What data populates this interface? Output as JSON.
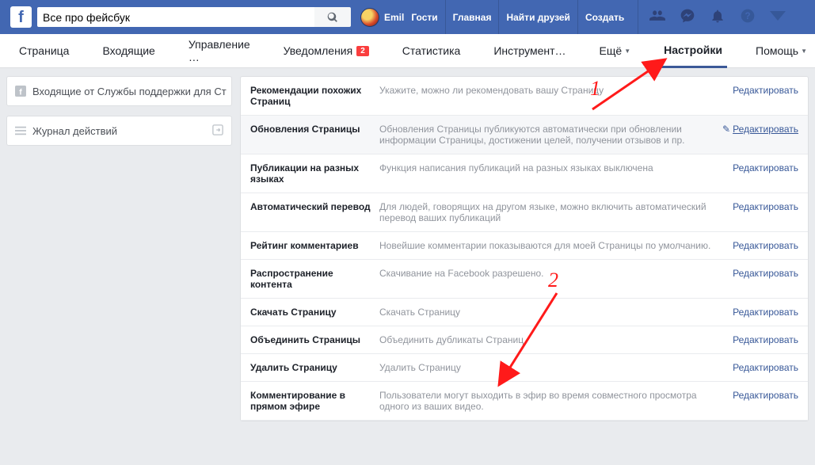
{
  "header": {
    "search_value": "Все про фейсбук",
    "user_name": "Emil",
    "nav": {
      "guests": "Гости",
      "home": "Главная",
      "find_friends": "Найти друзей",
      "create": "Создать"
    }
  },
  "tabs": {
    "page": "Страница",
    "inbox": "Входящие",
    "manage": "Управление …",
    "notifications": "Уведомления",
    "notifications_badge": "2",
    "insights": "Статистика",
    "tools": "Инструмент…",
    "more": "Ещё",
    "settings": "Настройки",
    "help": "Помощь"
  },
  "sidebar": {
    "support_inbox": "Входящие от Службы поддержки для Ст",
    "activity_log": "Журнал действий"
  },
  "rows": [
    {
      "label": "Рекомендации похожих Страниц",
      "desc": "Укажите, можно ли рекомендовать вашу Страницу",
      "highlight": false,
      "has_pencil": false,
      "underline": false
    },
    {
      "label": "Обновления Страницы",
      "desc": "Обновления Страницы публикуются автоматически при обновлении информации Страницы, достижении целей, получении отзывов и пр.",
      "highlight": true,
      "has_pencil": true,
      "underline": true
    },
    {
      "label": "Публикации на разных языках",
      "desc": "Функция написания публикаций на разных языках выключена",
      "highlight": false,
      "has_pencil": false,
      "underline": false
    },
    {
      "label": "Автоматический перевод",
      "desc": "Для людей, говорящих на другом языке, можно включить автоматический перевод ваших публикаций",
      "highlight": false,
      "has_pencil": false,
      "underline": false
    },
    {
      "label": "Рейтинг комментариев",
      "desc": "Новейшие комментарии показываются для моей Страницы по умолчанию.",
      "highlight": false,
      "has_pencil": false,
      "underline": false
    },
    {
      "label": "Распространение контента",
      "desc": "Скачивание на Facebook разрешено.",
      "highlight": false,
      "has_pencil": false,
      "underline": false
    },
    {
      "label": "Скачать Страницу",
      "desc": "Скачать Страницу",
      "highlight": false,
      "has_pencil": false,
      "underline": false
    },
    {
      "label": "Объединить Страницы",
      "desc": "Объединить дубликаты Страниц",
      "highlight": false,
      "has_pencil": false,
      "underline": false
    },
    {
      "label": "Удалить Страницу",
      "desc": "Удалить Страницу",
      "highlight": false,
      "has_pencil": false,
      "underline": false
    },
    {
      "label": "Комментирование в прямом эфире",
      "desc": "Пользователи могут выходить в эфир во время совместного просмотра одного из ваших видео.",
      "highlight": false,
      "has_pencil": false,
      "underline": false
    }
  ],
  "edit_label": "Редактировать",
  "annotations": {
    "one": "1",
    "two": "2"
  }
}
